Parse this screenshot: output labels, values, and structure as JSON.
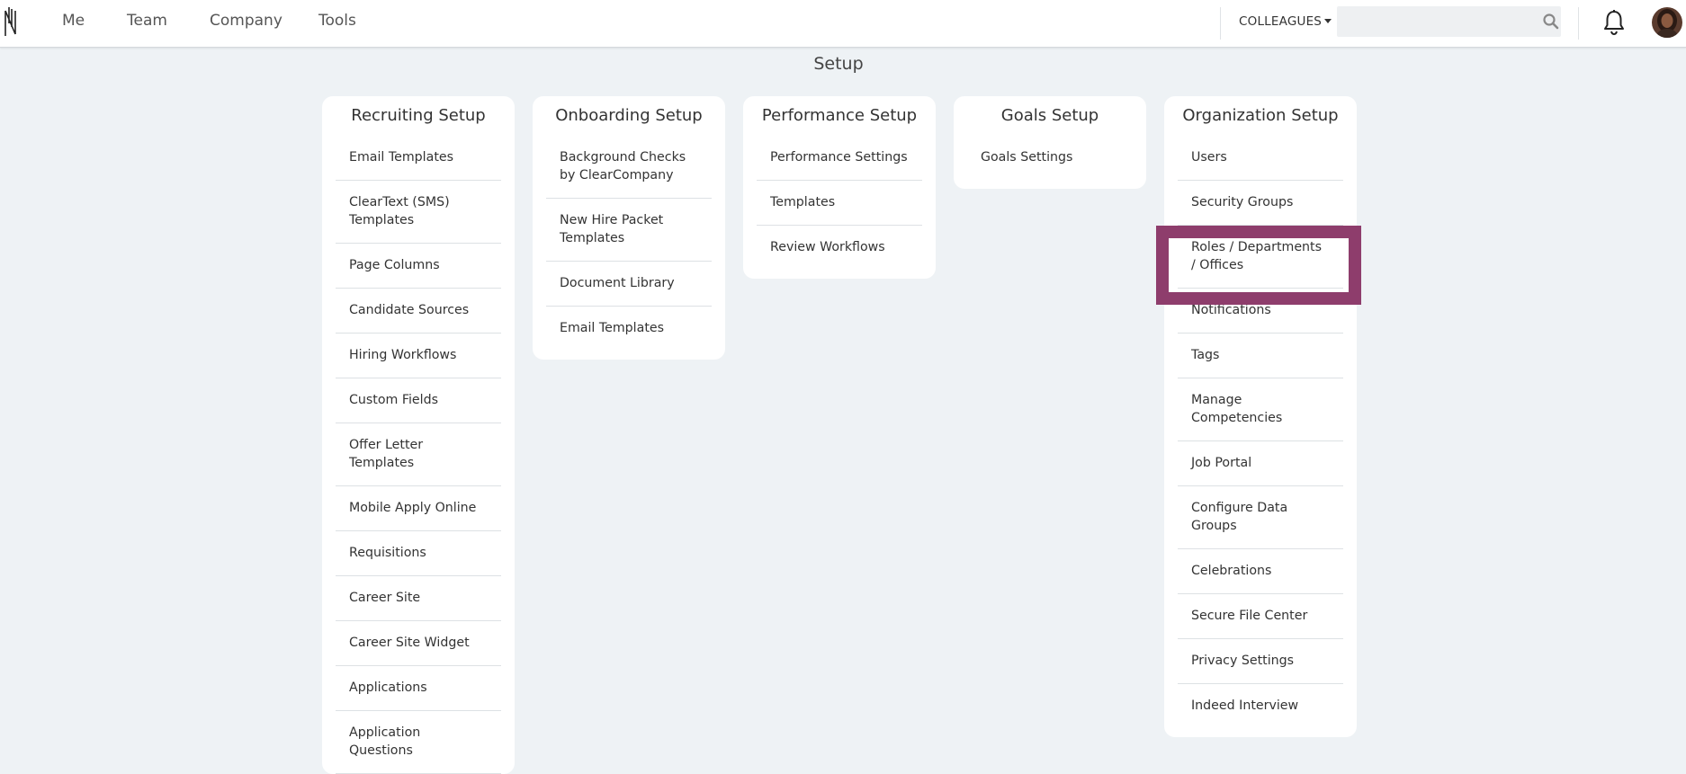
{
  "nav": {
    "logo_letter": "N",
    "links": [
      "Me",
      "Team",
      "Company",
      "Tools"
    ],
    "colleagues_label": "COLLEAGUES",
    "search_placeholder": ""
  },
  "page": {
    "title": "Setup"
  },
  "cards": [
    {
      "title": "Recruiting Setup",
      "items": [
        "Email Templates",
        "ClearText (SMS) Templates",
        "Page Columns",
        "Candidate Sources",
        "Hiring Workflows",
        "Custom Fields",
        "Offer Letter Templates",
        "Mobile Apply Online",
        "Requisitions",
        "Career Site",
        "Career Site Widget",
        "Applications",
        "Application Questions"
      ]
    },
    {
      "title": "Onboarding Setup",
      "items": [
        "Background Checks by ClearCompany",
        "New Hire Packet Templates",
        "Document Library",
        "Email Templates"
      ]
    },
    {
      "title": "Performance Setup",
      "items": [
        "Performance Settings",
        "Templates",
        "Review Workflows"
      ]
    },
    {
      "title": "Goals Setup",
      "items": [
        "Goals Settings"
      ]
    },
    {
      "title": "Organization Setup",
      "items": [
        "Users",
        "Security Groups",
        "Roles / Departments / Offices",
        "Notifications",
        "Tags",
        "Manage Competencies",
        "Job Portal",
        "Configure Data Groups",
        "Celebrations",
        "Secure File Center",
        "Privacy Settings",
        "Indeed Interview"
      ]
    }
  ],
  "highlighted_item": "Roles / Departments / Offices",
  "colors": {
    "highlight": "#8e3d6c",
    "background": "#eef2f5"
  }
}
